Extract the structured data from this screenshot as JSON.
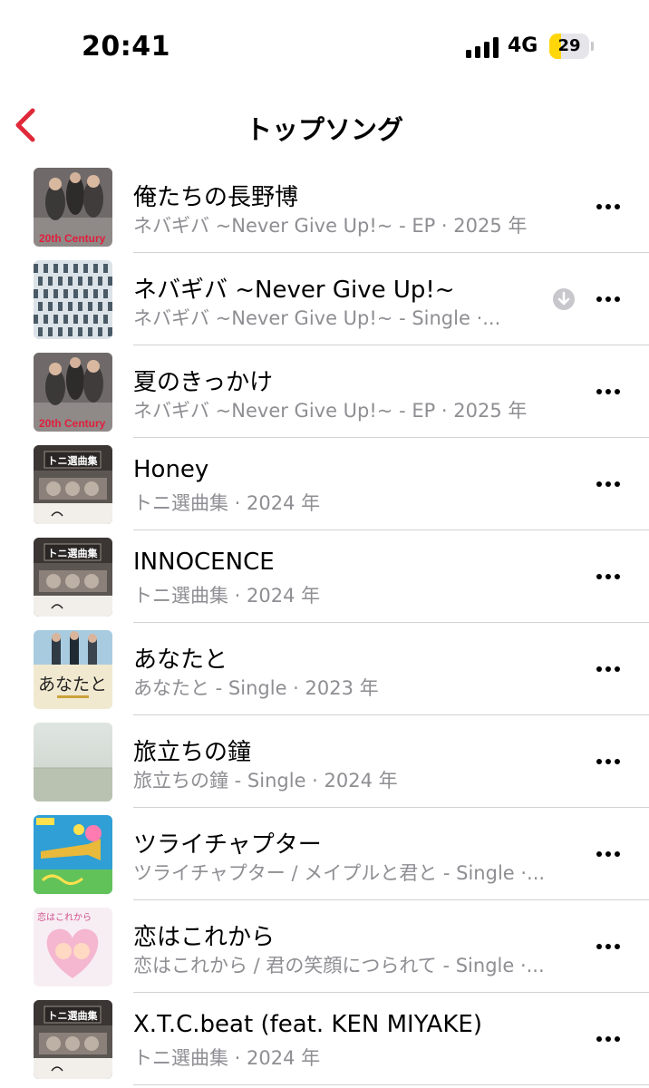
{
  "status_bar": {
    "time": "20:41",
    "network": "4G",
    "battery": "29",
    "battery_level": 0.29
  },
  "nav": {
    "title": "トップソング",
    "back_icon": "chevron-left-icon",
    "accent_color": "#e0293a"
  },
  "songs": [
    {
      "title": "俺たちの長野博",
      "subtitle": "ネバギバ ~Never Give Up!~ - EP · 2025 年",
      "art": "a",
      "art_text": "20th Century"
    },
    {
      "title": "ネバギバ ~Never Give Up!~",
      "subtitle": "ネバギバ ~Never Give Up!~ - Single ·...",
      "art": "b",
      "art_text": "",
      "downloaded": true
    },
    {
      "title": "夏のきっかけ",
      "subtitle": "ネバギバ ~Never Give Up!~ - EP · 2025 年",
      "art": "a",
      "art_text": "20th Century"
    },
    {
      "title": "Honey",
      "subtitle": "トニ選曲集 · 2024 年",
      "art": "c",
      "art_text": "トニ選曲集"
    },
    {
      "title": "INNOCENCE",
      "subtitle": "トニ選曲集 · 2024 年",
      "art": "c",
      "art_text": "トニ選曲集"
    },
    {
      "title": "あなたと",
      "subtitle": "あなたと - Single · 2023 年",
      "art": "d",
      "art_text": "あなたと"
    },
    {
      "title": "旅立ちの鐘",
      "subtitle": "旅立ちの鐘 - Single · 2024 年",
      "art": "e",
      "art_text": ""
    },
    {
      "title": "ツライチャプター",
      "subtitle": "ツライチャプター / メイプルと君と - Single ·...",
      "art": "f",
      "art_text": ""
    },
    {
      "title": "恋はこれから",
      "subtitle": "恋はこれから / 君の笑顔につられて - Single ·...",
      "art": "g",
      "art_text": "恋はこれから"
    },
    {
      "title": "X.T.C.beat (feat. KEN MIYAKE)",
      "subtitle": "トニ選曲集 · 2024 年",
      "art": "c",
      "art_text": "トニ選曲集"
    }
  ]
}
